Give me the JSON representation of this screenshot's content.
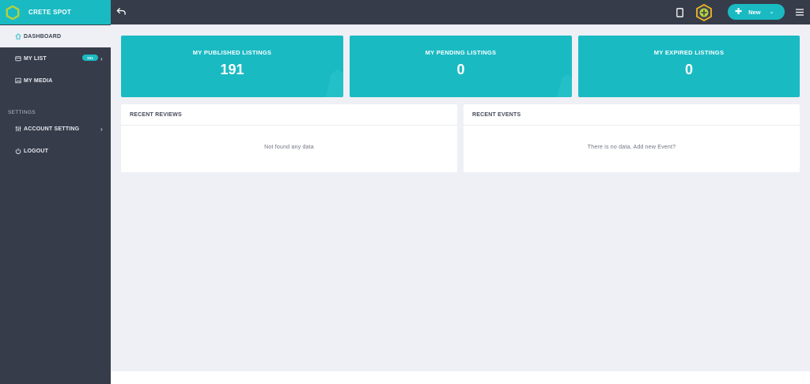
{
  "brand": {
    "name": "CRETE SPOT",
    "accent": "#1abac3",
    "sidebar_bg": "#373c4b"
  },
  "sidebar": {
    "items": [
      {
        "label": "DASHBOARD",
        "icon": "home-icon",
        "active": true
      },
      {
        "label": "MY LIST",
        "icon": "list-icon",
        "badge": "191",
        "has_submenu": true
      },
      {
        "label": "MY MEDIA",
        "icon": "image-icon"
      }
    ],
    "settings_section": "SETTINGS",
    "settings_items": [
      {
        "label": "ACCOUNT SETTING",
        "icon": "sliders-icon",
        "has_submenu": true
      },
      {
        "label": "LOGOUT",
        "icon": "power-icon"
      }
    ]
  },
  "topbar": {
    "back_icon": "back-arrow-icon",
    "device_icon": "tablet-icon",
    "avatar_icon": "user-avatar-icon",
    "new_button": {
      "label": "New",
      "icon": "plus-icon",
      "caret": "chevron-down-icon"
    },
    "menu_icon": "hamburger-menu-icon"
  },
  "stats": [
    {
      "title": "MY PUBLISHED LISTINGS",
      "value": "191"
    },
    {
      "title": "MY PENDING LISTINGS",
      "value": "0"
    },
    {
      "title": "MY EXPIRED LISTINGS",
      "value": "0"
    }
  ],
  "panels": {
    "reviews": {
      "title": "RECENT REVIEWS",
      "empty": "Not found any data"
    },
    "events": {
      "title": "RECENT EVENTS",
      "empty": "There is no data, Add new Event?"
    }
  }
}
